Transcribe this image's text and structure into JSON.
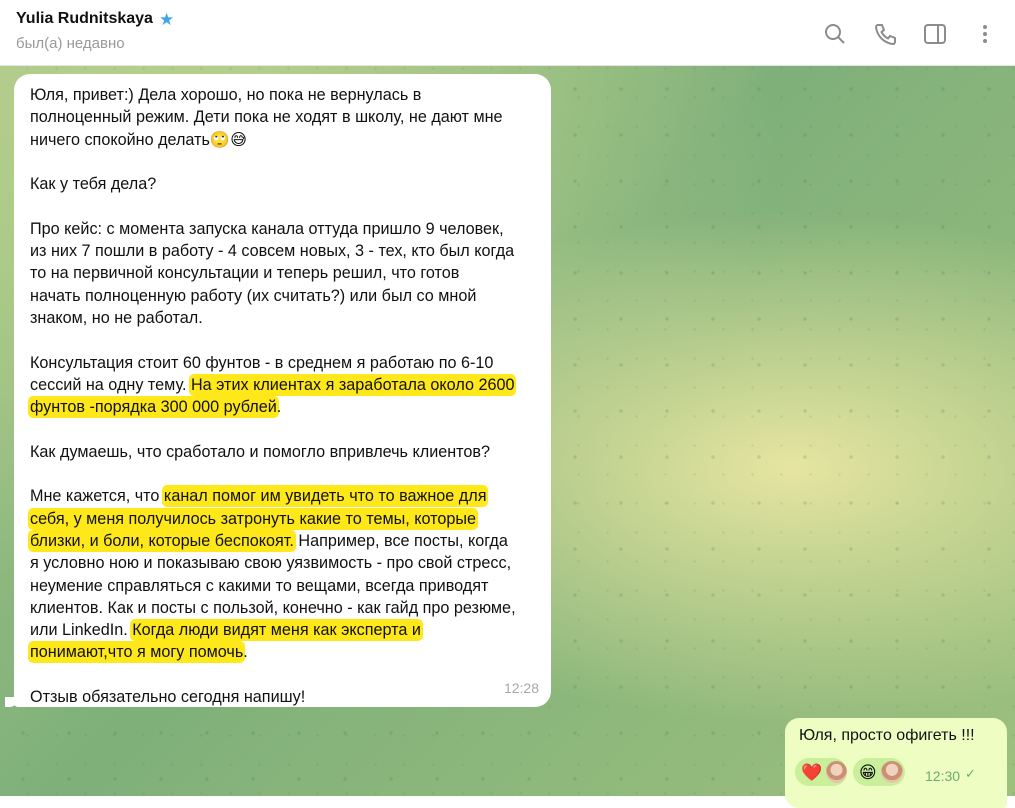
{
  "header": {
    "contact_name": "Yulia Rudnitskaya",
    "verified_icon": "star-icon",
    "status": "был(а) недавно",
    "icons": [
      "search-icon",
      "phone-icon",
      "sidebar-icon",
      "more-icon"
    ]
  },
  "messages": {
    "incoming": {
      "lines": [
        "Юля, привет:) Дела хорошо, но пока не вернулась в",
        "полноценный режим. Дети пока не ходят в школу, не дают мне",
        "ничего спокойно делать🙄😅",
        "",
        "Как у тебя дела?",
        "",
        "Про кейс: с момента запуска канала оттуда пришло 9 человек,",
        "из них 7 пошли в работу - 4 совсем новых, 3 - тех, кто был когда",
        "то на первичной консультации и теперь решил, что готов",
        "начать полноценную работу (их считать?) или был со мной",
        "знаком, но не работал.",
        "",
        "Консультация стоит 60 фунтов - в среднем я работаю по 6-10"
      ],
      "line13_plain": "сессий на одну тему. ",
      "line13_hl": "На этих клиентах я заработала около 2600",
      "line14_hl": "фунтов -порядка 300 000 рублей",
      "line14_plain": ".",
      "line16": "Как думаешь, что сработало и помогло впривлечь клиентов?",
      "line18_plain": "Мне кажется, что ",
      "line18_hl": "канал помог им увидеть что то важное для",
      "line19_hl": "себя, у меня получилось затронуть какие то темы, которые",
      "line20_hl": "близки, и боли, которые беспокоят.",
      "line20_plain": " Например, все посты, когда",
      "line21": "я условно ною и показываю свою уязвимость - про свой стресс,",
      "line22": "неумение справляться с какими то вещами, всегда приводят",
      "line23": "клиентов. Как и посты с пользой, конечно - как гайд про резюме,",
      "line24_plain": "или LinkedIn. ",
      "line24_hl": "Когда люди видят меня как эксперта и",
      "line25_hl": "понимают,что я могу помочь",
      "line25_plain": ".",
      "line27": "Отзыв обязательно сегодня напишу!",
      "time": "12:28"
    },
    "outgoing": {
      "text": "Юля, просто офигеть !!!",
      "time": "12:30",
      "reactions": [
        {
          "emoji": "❤️",
          "name": "heart"
        },
        {
          "emoji": "😁",
          "name": "grin"
        }
      ]
    }
  }
}
